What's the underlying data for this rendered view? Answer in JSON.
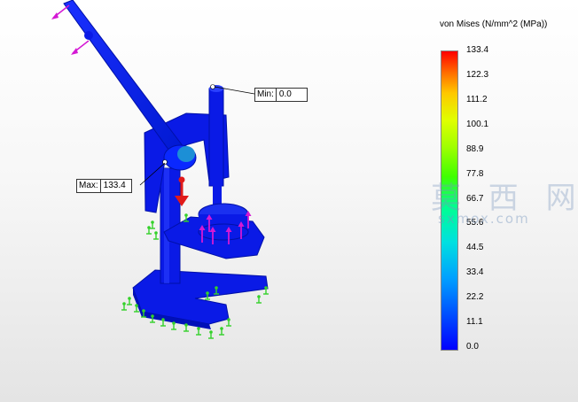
{
  "legend": {
    "title": "von Mises (N/mm^2 (MPa))",
    "ticks": [
      "133.4",
      "122.3",
      "111.2",
      "100.1",
      "88.9",
      "77.8",
      "66.7",
      "55.6",
      "44.5",
      "33.4",
      "22.2",
      "11.1",
      "0.0"
    ]
  },
  "probes": {
    "min": {
      "label": "Min:",
      "value": "0.0"
    },
    "max": {
      "label": "Max:",
      "value": "133.4"
    }
  },
  "watermark": {
    "chinese": "莫 西 网",
    "url": "sxmox.com"
  },
  "colors": {
    "part": "#0a1ae6",
    "fixture": "#34d12a",
    "load_arrow": "#d418d4",
    "gravity_arrow": "#e11a1a",
    "max_stress": "#ff0000",
    "min_stress": "#0000ff"
  },
  "icons": [
    "fixture-anchor-icon",
    "load-arrow-icon",
    "gravity-arrow-icon"
  ]
}
